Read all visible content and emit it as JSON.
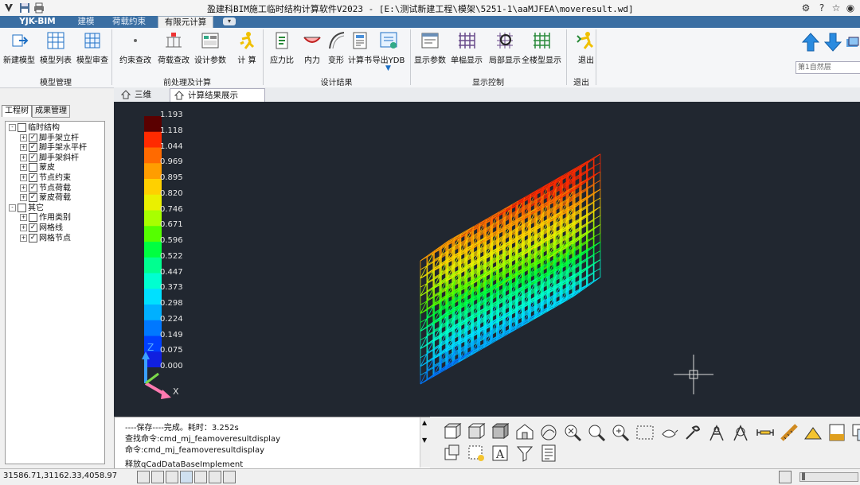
{
  "titlebar": {
    "title": "盈建科BIM施工临时结构计算软件V2023 - [E:\\测试新建工程\\模架\\5251-1\\aaMJFEA\\moveresult.wd]"
  },
  "tabs": {
    "brand": "YJK-BIM",
    "items": [
      "建模",
      "荷载约束",
      "有限元计算"
    ],
    "active": "有限元计算"
  },
  "ribbon": {
    "buttons": [
      {
        "label": "新建模型",
        "icon": "new-model-icon"
      },
      {
        "label": "模型列表",
        "icon": "model-list-icon"
      },
      {
        "label": "模型审查",
        "icon": "model-check-icon"
      },
      {
        "label": "约束查改",
        "icon": "constraint-icon"
      },
      {
        "label": "荷载查改",
        "icon": "load-icon"
      },
      {
        "label": "设计参数",
        "icon": "design-params-icon"
      },
      {
        "label": "计 算",
        "icon": "calculate-runner-icon"
      },
      {
        "label": "应力比",
        "icon": "stress-ratio-icon"
      },
      {
        "label": "内力",
        "icon": "internal-force-icon"
      },
      {
        "label": "变形",
        "icon": "deformation-icon"
      },
      {
        "label": "计算书",
        "icon": "report-icon"
      },
      {
        "label": "导出YDB",
        "icon": "export-ydb-icon"
      },
      {
        "label": "显示参数",
        "icon": "display-params-icon"
      },
      {
        "label": "单榀显示",
        "icon": "single-frame-icon"
      },
      {
        "label": "局部显示",
        "icon": "local-display-icon"
      },
      {
        "label": "全楼型显示",
        "icon": "full-model-icon"
      },
      {
        "label": "退出",
        "icon": "exit-runner-icon"
      }
    ],
    "groups": [
      "模型管理",
      "前处理及计算",
      "设计结果",
      "显示控制",
      "退出"
    ]
  },
  "navpanel": {
    "floor_select": "第1自然层"
  },
  "viewtabs": [
    "三维",
    "计算结果展示"
  ],
  "leftpanel": {
    "tabs": [
      "工程树",
      "成果管理"
    ],
    "tree": [
      {
        "label": "临时结构",
        "level": 0,
        "checked": false,
        "expand": "-"
      },
      {
        "label": "脚手架立杆",
        "level": 1,
        "checked": true,
        "expand": "+"
      },
      {
        "label": "脚手架水平杆",
        "level": 1,
        "checked": true,
        "expand": "+"
      },
      {
        "label": "脚手架斜杆",
        "level": 1,
        "checked": true,
        "expand": "+"
      },
      {
        "label": "蒙皮",
        "level": 1,
        "checked": false,
        "expand": "+"
      },
      {
        "label": "节点约束",
        "level": 1,
        "checked": true,
        "expand": "+"
      },
      {
        "label": "节点荷载",
        "level": 1,
        "checked": true,
        "expand": "+"
      },
      {
        "label": "蒙皮荷载",
        "level": 1,
        "checked": true,
        "expand": "+"
      },
      {
        "label": "其它",
        "level": 0,
        "checked": false,
        "expand": "-"
      },
      {
        "label": "作用类别",
        "level": 1,
        "checked": false,
        "expand": "+"
      },
      {
        "label": "网格线",
        "level": 1,
        "checked": true,
        "expand": "+"
      },
      {
        "label": "网格节点",
        "level": 1,
        "checked": true,
        "expand": "+"
      }
    ]
  },
  "legend": {
    "values": [
      "1.193",
      "1.118",
      "1.044",
      "0.969",
      "0.895",
      "0.820",
      "0.746",
      "0.671",
      "0.596",
      "0.522",
      "0.447",
      "0.373",
      "0.298",
      "0.224",
      "0.149",
      "0.075",
      "0.000"
    ],
    "colors": [
      "#5a0000",
      "#ff2a00",
      "#ff6a00",
      "#ff9d00",
      "#ffd000",
      "#eaf000",
      "#a8ff00",
      "#55ff00",
      "#00ff40",
      "#00ff90",
      "#00ffd0",
      "#00e0ff",
      "#00b0ff",
      "#0078ff",
      "#0040ff",
      "#1020e0"
    ]
  },
  "axis": {
    "z": "Z",
    "x": "X"
  },
  "command": {
    "lines": [
      "----保存----完成。耗时：3.252s",
      "查找命令:cmd_mj_feamoveresultdisplay",
      "命令:cmd_mj_feamoveresultdisplay"
    ],
    "input": "释放qCadDataBaseImplement"
  },
  "status": {
    "coords": "31586.71,31162.33,4058.97"
  }
}
